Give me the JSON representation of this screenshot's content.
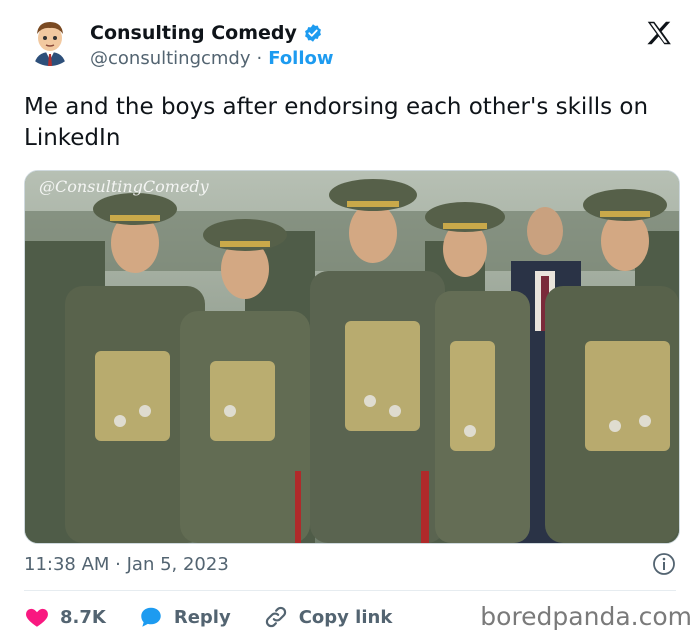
{
  "account": {
    "display_name": "Consulting Comedy",
    "handle": "@consultingcmdy",
    "separator": "·",
    "follow_label": "Follow",
    "verified_color": "#1d9bf0"
  },
  "tweet": {
    "text": "Me and the boys after endorsing each other's skills on LinkedIn",
    "timestamp": "11:38 AM · Jan 5, 2023"
  },
  "media": {
    "watermark": "@ConsultingComedy",
    "description_icon": "photo"
  },
  "actions": {
    "like_count": "8.7K",
    "reply_label": "Reply",
    "copy_link_label": "Copy link"
  },
  "footer": {
    "brand": "boredpanda.com"
  },
  "colors": {
    "accent": "#1d9bf0",
    "like": "#f91880",
    "muted": "#536471",
    "text": "#0f1419"
  }
}
